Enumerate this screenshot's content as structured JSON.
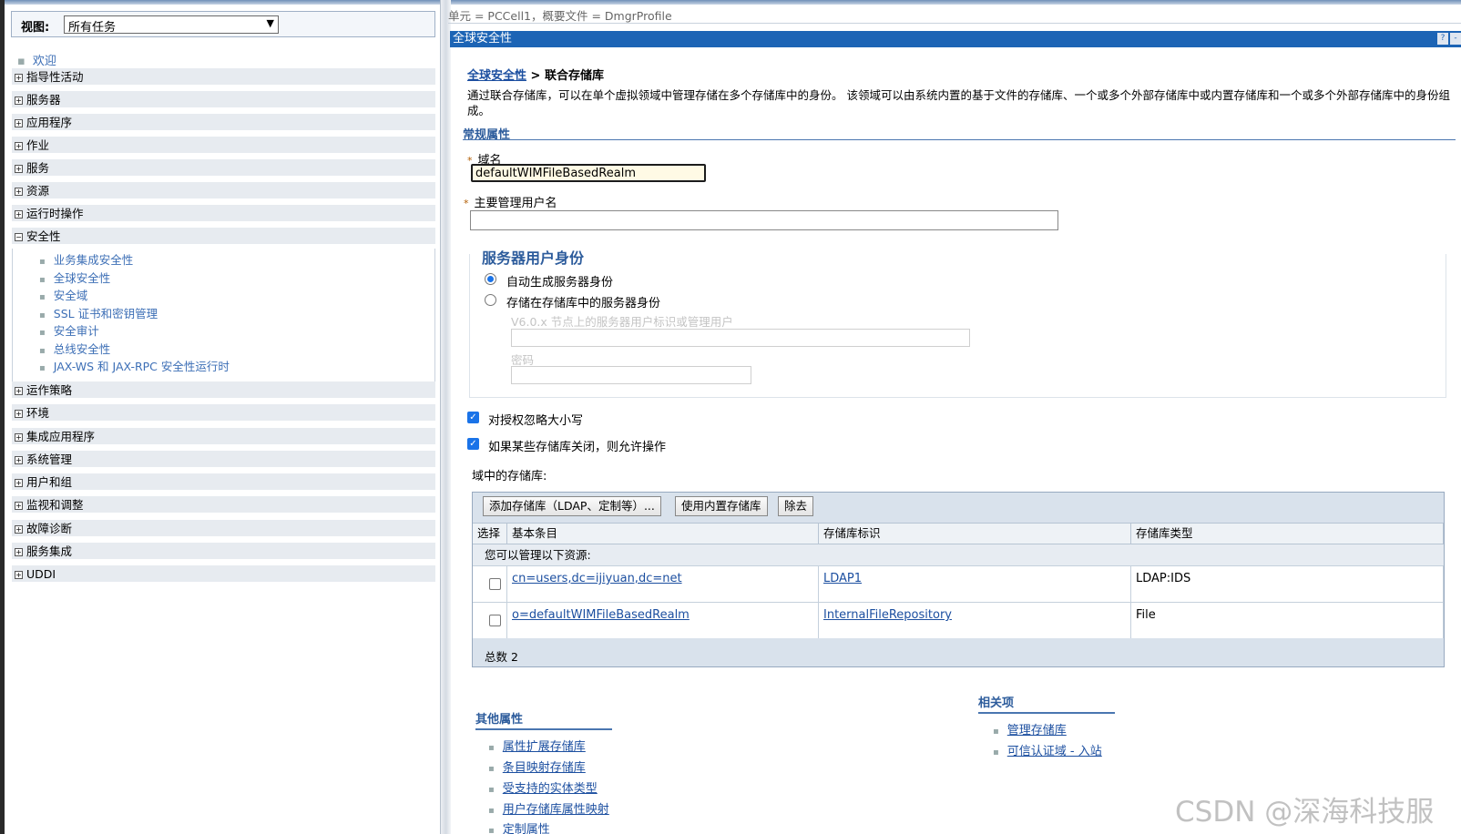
{
  "nav": {
    "view_label": "视图:",
    "view_value": "所有任务",
    "welcome": "欢迎",
    "groups_top": [
      "指导性活动",
      "服务器",
      "应用程序",
      "作业",
      "服务",
      "资源",
      "运行时操作"
    ],
    "security": {
      "label": "安全性",
      "items": [
        "业务集成安全性",
        "全球安全性",
        "安全域",
        "SSL 证书和密钥管理",
        "安全审计",
        "总线安全性",
        "JAX-WS 和 JAX-RPC 安全性运行时"
      ]
    },
    "groups_bottom": [
      "运作策略",
      "环境",
      "集成应用程序",
      "系统管理",
      "用户和组",
      "监视和调整",
      "故障诊断",
      "服务集成",
      "UDDI"
    ]
  },
  "content": {
    "scope_line": "单元 = PCCell1，概要文件 = DmgrProfile",
    "title": "全球安全性",
    "help_icon": "?",
    "min_icon": "-",
    "breadcrumb_link": "全球安全性",
    "breadcrumb_sep": " > ",
    "breadcrumb_current": "联合存储库",
    "description": "通过联合存储库，可以在单个虚拟领域中管理存储在多个存储库中的身份。 该领域可以由系统内置的基于文件的存储库、一个或多个外部存储库中或内置存储库和一个或多个外部存储库中的身份组成。",
    "general_props": "常规属性",
    "required_mark": "*",
    "realm_label": "域名",
    "realm_value": "defaultWIMFileBasedRealm",
    "admin_label": "主要管理用户名",
    "admin_value": "",
    "server_identity": {
      "legend": "服务器用户身份",
      "auto_label": "自动生成服务器身份",
      "stored_label": "存储在存储库中的服务器身份",
      "v6_label": "V6.0.x 节点上的服务器用户标识或管理用户",
      "password_label": "密码"
    },
    "ignore_case_label": "对授权忽略大小写",
    "allow_ops_label": "如果某些存储库关闭，则允许操作",
    "repos_label": "域中的存储库:",
    "table": {
      "buttons": [
        "添加存储库（LDAP、定制等）...",
        "使用内置存储库",
        "除去"
      ],
      "headers": [
        "选择",
        "基本条目",
        "存储库标识",
        "存储库类型"
      ],
      "manage_text": "您可以管理以下资源:",
      "rows": [
        {
          "entry": "cn=users,dc=ijiyuan,dc=net",
          "id": "LDAP1",
          "type": "LDAP:IDS"
        },
        {
          "entry": "o=defaultWIMFileBasedRealm",
          "id": "InternalFileRepository",
          "type": "File"
        }
      ],
      "total": "总数 2"
    },
    "other_props": {
      "title": "其他属性",
      "links": [
        "属性扩展存储库",
        "条目映射存储库",
        "受支持的实体类型",
        "用户存储库属性映射",
        "定制属性"
      ]
    },
    "related": {
      "title": "相关项",
      "links": [
        "管理存储库",
        "可信认证域 - 入站"
      ]
    }
  },
  "watermark": "CSDN @深海科技服务",
  "colors": {
    "title_bar": "#1c64b5",
    "link": "#1c4fa0",
    "section": "#2d5c9c",
    "nav_row": "#e7ebf0"
  }
}
